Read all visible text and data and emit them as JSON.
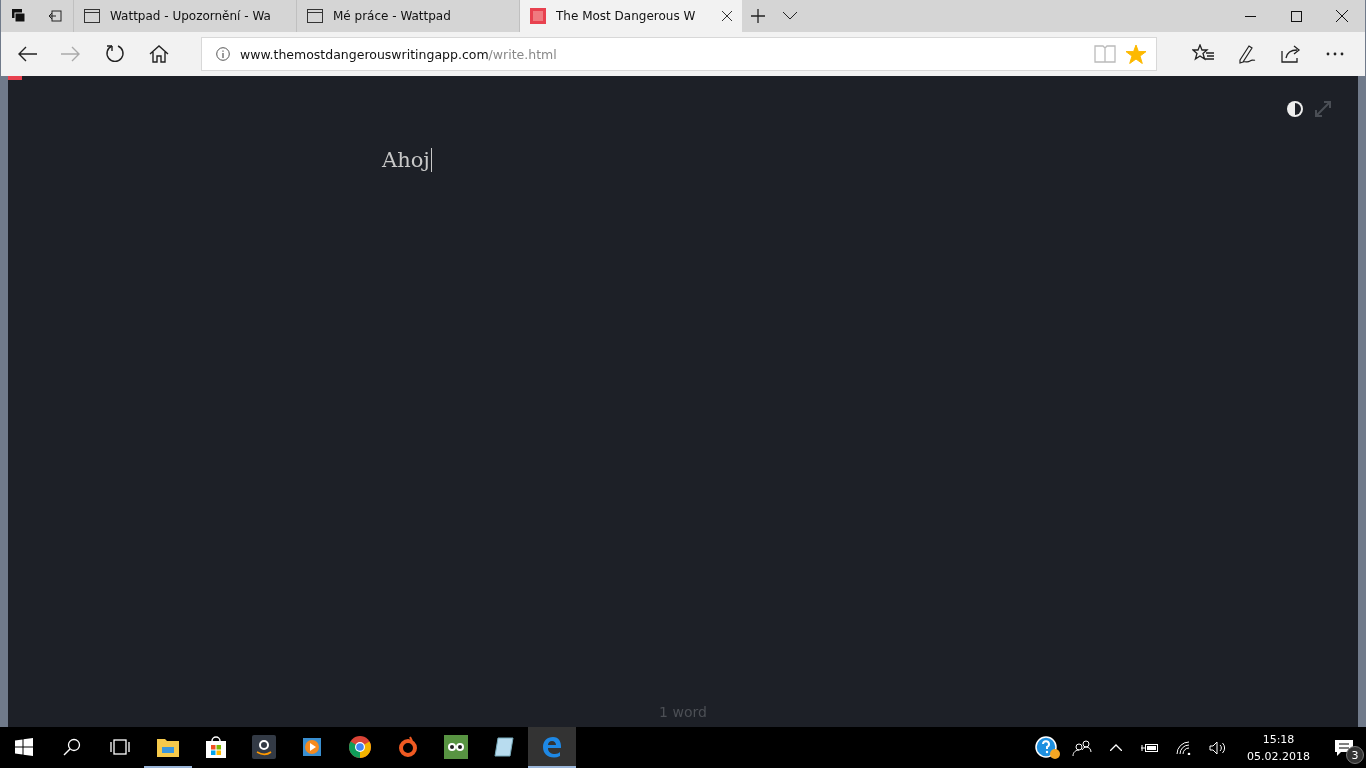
{
  "browser": {
    "tabs": [
      {
        "title": "Wattpad - Upozornění - Wa",
        "kind": "page",
        "selected": false
      },
      {
        "title": "Mé práce - Wattpad",
        "kind": "page",
        "selected": false
      },
      {
        "title": "The Most Dangerous W",
        "kind": "app",
        "selected": true
      }
    ],
    "address": {
      "domain": "www.themostdangerouswritingapp.com",
      "path": "/write.html"
    },
    "favorite": true
  },
  "editor": {
    "progress": {
      "level": 0.01
    },
    "text": "Ahoj",
    "word_count": "1 word"
  },
  "taskbar": {
    "apps": [
      {
        "kind": "explorer",
        "running": true,
        "selected": false
      },
      {
        "kind": "store",
        "running": false,
        "selected": false
      },
      {
        "kind": "amazon",
        "running": false,
        "selected": false
      },
      {
        "kind": "media",
        "running": false,
        "selected": false
      },
      {
        "kind": "chrome",
        "running": false,
        "selected": false
      },
      {
        "kind": "origin",
        "running": false,
        "selected": false
      },
      {
        "kind": "owl",
        "running": false,
        "selected": false
      },
      {
        "kind": "notepad",
        "running": false,
        "selected": false
      },
      {
        "kind": "edge",
        "running": true,
        "selected": true
      }
    ],
    "time": "15:18",
    "date": "05.02.2018",
    "notifications": "3"
  }
}
